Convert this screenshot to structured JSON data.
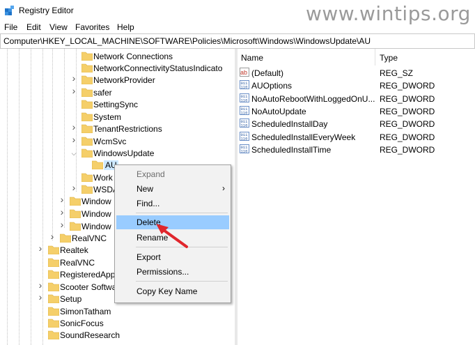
{
  "window": {
    "title": "Registry Editor"
  },
  "watermark": "www.wintips.org",
  "menu": [
    "File",
    "Edit",
    "View",
    "Favorites",
    "Help"
  ],
  "address": "Computer\\HKEY_LOCAL_MACHINE\\SOFTWARE\\Policies\\Microsoft\\Windows\\WindowsUpdate\\AU",
  "tree": {
    "nodes": [
      {
        "label": "Network Connections"
      },
      {
        "label": "NetworkConnectivityStatusIndicato"
      },
      {
        "label": "NetworkProvider"
      },
      {
        "label": "safer"
      },
      {
        "label": "SettingSync"
      },
      {
        "label": "System"
      },
      {
        "label": "TenantRestrictions"
      },
      {
        "label": "WcmSvc"
      },
      {
        "label": "WindowsUpdate"
      },
      {
        "label": "AU"
      },
      {
        "label": "Work"
      },
      {
        "label": "WSDA"
      },
      {
        "label": "Window"
      },
      {
        "label": "Window"
      },
      {
        "label": "Window"
      },
      {
        "label": "RealVNC"
      },
      {
        "label": "Realtek"
      },
      {
        "label": "RealVNC"
      },
      {
        "label": "RegisteredApp"
      },
      {
        "label": "Scooter Softwa"
      },
      {
        "label": "Setup"
      },
      {
        "label": "SimonTatham"
      },
      {
        "label": "SonicFocus"
      },
      {
        "label": "SoundResearch"
      }
    ]
  },
  "list": {
    "columns": {
      "name": "Name",
      "type": "Type"
    },
    "rows": [
      {
        "name": "(Default)",
        "type": "REG_SZ",
        "icon": "string-value-icon"
      },
      {
        "name": "AUOptions",
        "type": "REG_DWORD",
        "icon": "dword-value-icon"
      },
      {
        "name": "NoAutoRebootWithLoggedOnU...",
        "type": "REG_DWORD",
        "icon": "dword-value-icon"
      },
      {
        "name": "NoAutoUpdate",
        "type": "REG_DWORD",
        "icon": "dword-value-icon"
      },
      {
        "name": "ScheduledInstallDay",
        "type": "REG_DWORD",
        "icon": "dword-value-icon"
      },
      {
        "name": "ScheduledInstallEveryWeek",
        "type": "REG_DWORD",
        "icon": "dword-value-icon"
      },
      {
        "name": "ScheduledInstallTime",
        "type": "REG_DWORD",
        "icon": "dword-value-icon"
      }
    ]
  },
  "context_menu": {
    "expand": "Expand",
    "new": "New",
    "find": "Find...",
    "delete": "Delete",
    "rename": "Rename",
    "export": "Export",
    "permissions": "Permissions...",
    "copy_key_name": "Copy Key Name"
  },
  "colors": {
    "folder": "#f5cf6a",
    "selection": "#cce8ff",
    "menu_highlight": "#99ccff",
    "arrow": "#e0262c"
  }
}
